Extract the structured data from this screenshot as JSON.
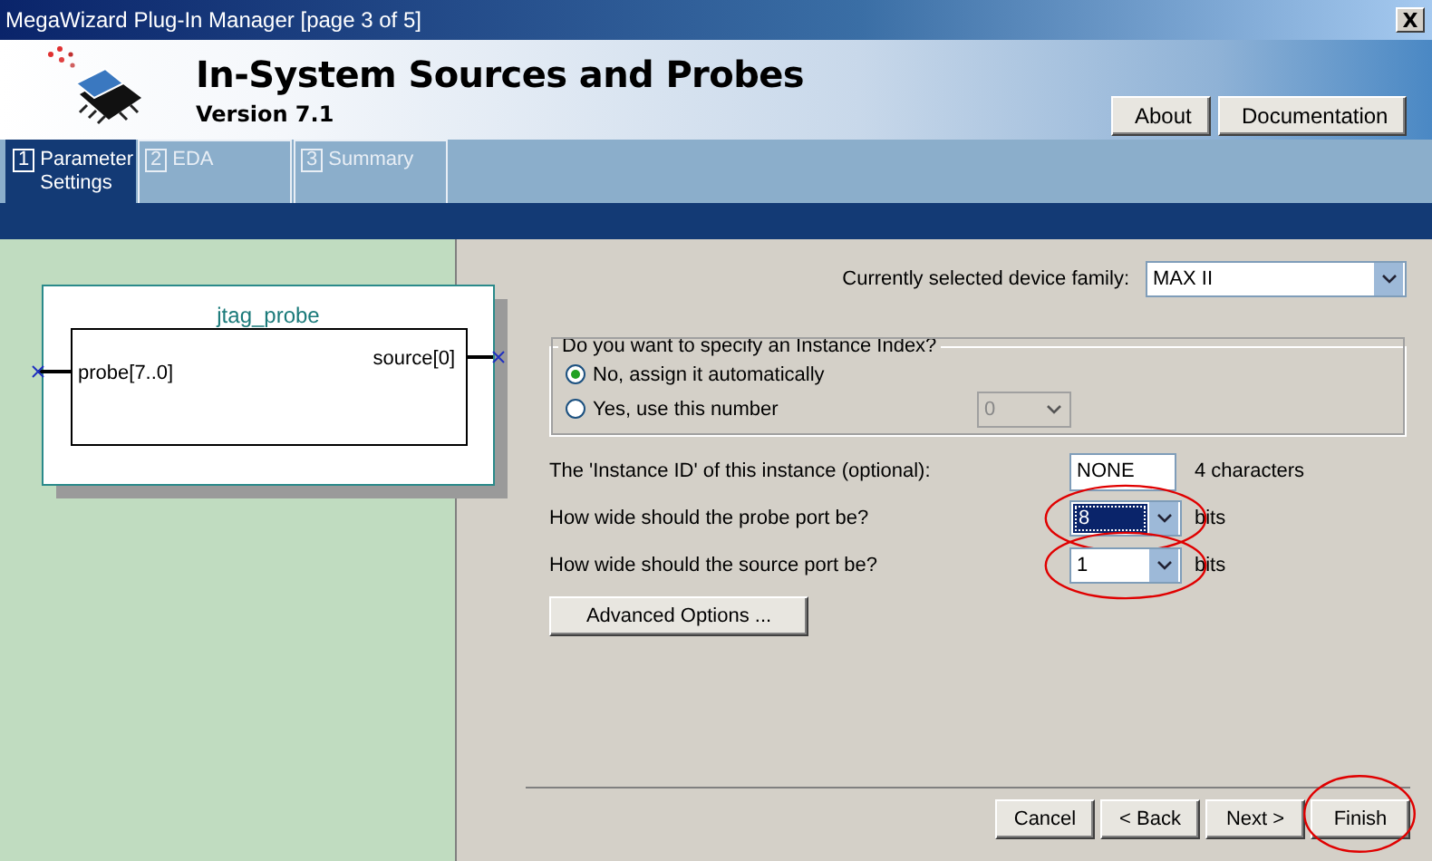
{
  "window": {
    "title": "MegaWizard Plug-In Manager [page 3 of 5]",
    "close": "X"
  },
  "header": {
    "title": "In-System Sources and Probes",
    "version": "Version 7.1",
    "buttons": [
      "About",
      "Documentation"
    ]
  },
  "tabs": [
    {
      "number": "1",
      "label": "Parameter Settings",
      "selected": true
    },
    {
      "number": "2",
      "label": "EDA",
      "selected": false
    },
    {
      "number": "3",
      "label": "Summary",
      "selected": false
    }
  ],
  "diagram": {
    "name": "jtag_probe",
    "input": "probe[7..0]",
    "output": "source[0]"
  },
  "form": {
    "device_family": {
      "label": "Currently selected device family:",
      "value": "MAX II"
    },
    "instance_index": {
      "legend": "Do you want to specify an Instance Index?",
      "options": [
        {
          "label": "No, assign it automatically",
          "selected": true
        },
        {
          "label": "Yes, use this number",
          "selected": false
        }
      ],
      "number": {
        "value": "0",
        "disabled": true
      }
    },
    "rows": [
      {
        "kind": "text",
        "label": "The 'Instance ID' of this instance (optional):",
        "value": "NONE",
        "unit": "4 characters",
        "circled": false,
        "highlighted": false
      },
      {
        "kind": "combo",
        "label": "How wide should the probe port be?",
        "value": "8",
        "unit": "bits",
        "circled": true,
        "highlighted": true
      },
      {
        "kind": "combo",
        "label": "How wide should the source port be?",
        "value": "1",
        "unit": "bits",
        "circled": true,
        "highlighted": false
      }
    ],
    "advanced": "Advanced Options ..."
  },
  "footer": {
    "buttons": [
      {
        "label": "Cancel",
        "circled": false
      },
      {
        "label": "< Back",
        "circled": false
      },
      {
        "label": "Next >",
        "circled": false
      },
      {
        "label": "Finish",
        "circled": true
      }
    ]
  }
}
